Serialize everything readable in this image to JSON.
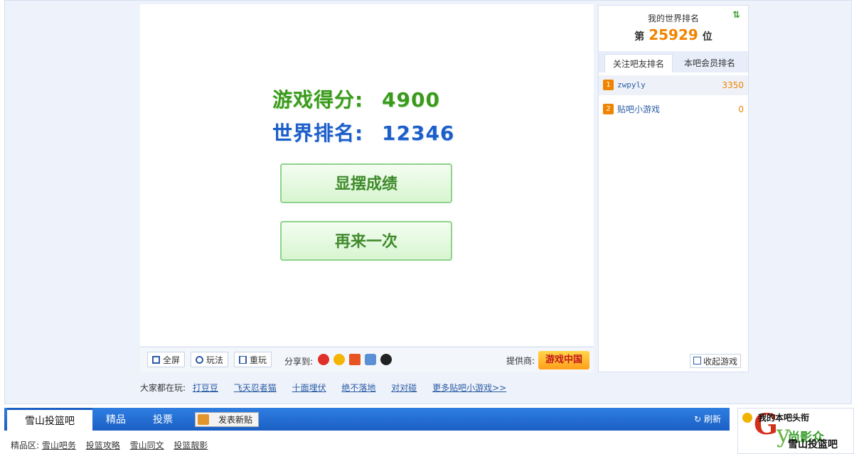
{
  "game": {
    "score_label": "游戏得分:",
    "score_value": "4900",
    "world_rank_label": "世界排名:",
    "world_rank_value": "12346",
    "show_button": "显摆成绩",
    "replay_button": "再来一次"
  },
  "toolbar": {
    "fullscreen": "全屏",
    "howto": "玩法",
    "restart": "重玩",
    "share_label": "分享到:",
    "share_icons": [
      "weibo-icon",
      "qzone-icon",
      "renren-icon",
      "kaixin-icon",
      "qq-icon"
    ],
    "provider_label": "提供商:",
    "provider_logo": "游戏中国"
  },
  "everyone": {
    "label": "大家都在玩:",
    "games": [
      "打豆豆",
      "飞天忍者猫",
      "十面埋伏",
      "绝不落地",
      "对对碰",
      "更多贴吧小游戏>>"
    ]
  },
  "ranking": {
    "title": "我的世界排名",
    "prefix": "第",
    "value": "25929",
    "suffix": "位",
    "tabs": [
      "关注吧友排名",
      "本吧会员排名"
    ],
    "rows": [
      {
        "rank": "1",
        "name": "zwpyly",
        "score": "3350"
      },
      {
        "rank": "2",
        "name": "贴吧小游戏",
        "score": "0"
      }
    ],
    "collapse_button": "收起游戏"
  },
  "navbar": {
    "home": "雪山投篮吧",
    "items": [
      "精品",
      "投票"
    ],
    "post_button": "发表新贴",
    "refresh": "刷新"
  },
  "sub": {
    "label": "精品区:",
    "links": [
      "雪山吧务",
      "投篮攻略",
      "雪山同文",
      "投篮靓影"
    ]
  },
  "headline": {
    "title": "我的本吧头衔",
    "logo_text": "尚影众",
    "bar_name": "雪山投篮吧"
  },
  "colors": {
    "accent_blue": "#1a5fc4",
    "score_green": "#3a9a1e",
    "rank_orange": "#f08400"
  }
}
